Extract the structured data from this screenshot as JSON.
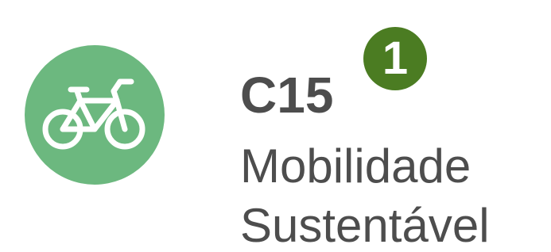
{
  "icon": {
    "name": "bicycle-icon",
    "background_color": "#6cb87f"
  },
  "badge": {
    "number": "1",
    "color": "#4b7c22"
  },
  "title": {
    "code": "C15",
    "line1": "Mobilidade",
    "line2": "Sustentável",
    "color": "#4d4d4d"
  }
}
